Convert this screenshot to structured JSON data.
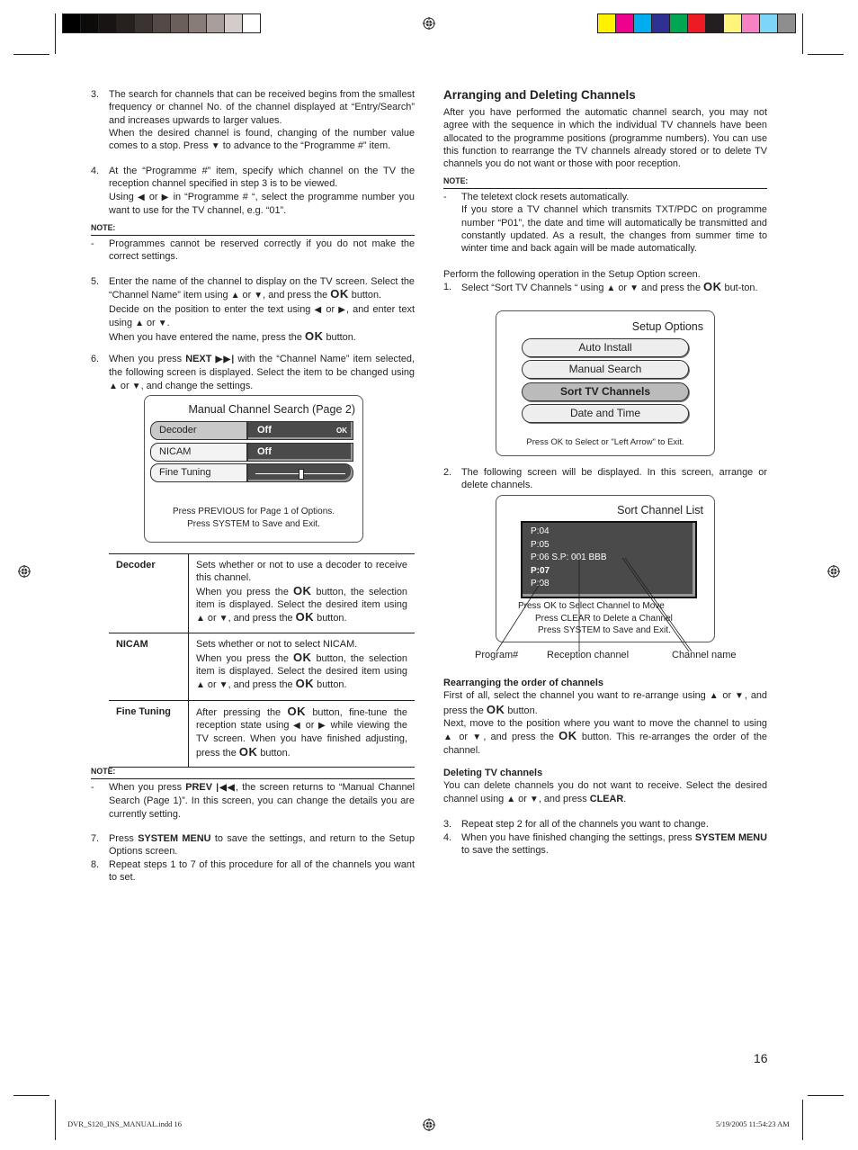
{
  "print_marks": {
    "gray_bar": [
      "#000000",
      "#0d0b0a",
      "#181413",
      "#26211f",
      "#3b3331",
      "#534a47",
      "#6b5f5b",
      "#887c78",
      "#a89e9b",
      "#d4cccb",
      "#ffffff"
    ],
    "color_bar": [
      "#fff200",
      "#ec008c",
      "#00aeef",
      "#2e3192",
      "#00a651",
      "#ed1c24",
      "#231f20",
      "#fff57d",
      "#f682c3",
      "#7dd6f7",
      "#8e8e8e"
    ],
    "footer_file": "DVR_S120_INS_MANUAL.indd   16",
    "footer_timestamp": "5/19/2005   11:54:23 AM"
  },
  "page_number": "16",
  "left": {
    "step3": {
      "num": "3.",
      "text1": "The search for channels that can be received begins from the smallest frequency or channel No. of the channel displayed at “Entry/Search” and increases upwards to larger values.",
      "text2a": "When the desired channel is found, changing of the number value comes to a stop. Press ",
      "text2b": " to advance to the “Programme #” item."
    },
    "step4": {
      "num": "4.",
      "text1": "At the “Programme #” item, specify which channel on the TV the reception channel specified in step 3 is to be viewed.",
      "text2a": "Using ",
      "text2b": " or ",
      "text2c": " in “Programme # “, select the programme number you want to use for the TV channel, e.g. “01”."
    },
    "note1": {
      "label": "NOTE:",
      "dash": "-",
      "text": "Programmes cannot be reserved correctly if you do not make the correct settings."
    },
    "step5": {
      "num": "5.",
      "a": "Enter the name of the channel to display on the TV screen. Select the “Channel Name” item using ",
      "b": " or ",
      "c": ", and press the ",
      "d": " button.",
      "e": "Decide on the position to enter the text using ",
      "f": " or ",
      "g": ", and enter text using ",
      "h": " or ",
      "i": ".",
      "j": "When you have entered the name, press the ",
      "k": " button."
    },
    "step6": {
      "num": "6.",
      "a": "When you press ",
      "next": "NEXT",
      "b": " with the “Channel Name” item selected, the following screen is displayed. Select the item to be changed using ",
      "c": " or ",
      "d": ", and change the settings."
    },
    "manual_screen": {
      "title": "Manual Channel Search  (Page 2)",
      "rows": [
        {
          "label": "Decoder",
          "value": "Off",
          "hint": "OK"
        },
        {
          "label": "NICAM",
          "value": "Off"
        },
        {
          "label": "Fine Tuning",
          "slider_position": 0.5
        }
      ],
      "footer1": "Press PREVIOUS for Page 1 of Options.",
      "footer2": "Press SYSTEM to Save and Exit."
    },
    "table": [
      {
        "key": "Decoder",
        "a": "Sets whether or not to use a decoder to receive this channel.",
        "b": "When you press the ",
        "c": " button, the selection item is displayed. Select the desired item using ",
        "d": " or ",
        "e": ", and press the ",
        "f": " button."
      },
      {
        "key": "NICAM",
        "a": "Sets whether or not to select NICAM.",
        "b": "When you press the ",
        "c": " button, the selection item is displayed. Select the desired item using ",
        "d": " or ",
        "e": ", and press the ",
        "f": " button."
      },
      {
        "key": "Fine Tuning",
        "a": "After pressing the ",
        "b": " button, fine-tune the reception state using ",
        "c": " or ",
        "d": " while viewing the TV screen. When you have finished adjusting, press the ",
        "e": " button."
      }
    ],
    "note2": {
      "label": "NOTE:",
      "dash": "-",
      "a": "When you press ",
      "prev": "PREV",
      "b": ", the screen returns to “Manual Channel Search (Page 1)”. In this screen, you can change the details you are currently setting."
    },
    "step7": {
      "num": "7.",
      "a": "Press ",
      "bold": "SYSTEM MENU",
      "b": " to save the settings, and return to the Setup Options screen."
    },
    "step8": {
      "num": "8.",
      "text": "Repeat steps 1 to 7 of this procedure for all of the channels you want to set."
    }
  },
  "right": {
    "heading": "Arranging and Deleting Channels",
    "intro": "After you have performed the automatic channel search, you may not agree with the sequence in which the individual TV channels have been allocated to the programme positions (programme numbers). You can use this function to rearrange the TV channels already stored or to delete TV channels you do not want or those with poor reception.",
    "note": {
      "label": "NOTE:",
      "dash": "-",
      "text1": "The teletext clock resets automatically.",
      "text2": "If you store a TV channel which transmits TXT/PDC on programme number “P01”, the date and time will automatically be transmitted and constantly updated. As a result, the changes from summer time to winter time and back again will be made automatically."
    },
    "perform": "Perform the following operation in the Setup Option screen.",
    "step1": {
      "num": "1.",
      "a": "Select “Sort TV Channels “ using ",
      "b": " or ",
      "c": " and press the ",
      "d": " but-ton."
    },
    "setup_screen": {
      "title": "Setup Options",
      "items": [
        {
          "label": "Auto Install",
          "selected": false
        },
        {
          "label": "Manual Search",
          "selected": false
        },
        {
          "label": "Sort TV Channels",
          "selected": true
        },
        {
          "label": "Date and Time",
          "selected": false
        }
      ],
      "footer": "Press OK to Select or \"Left Arrow\" to Exit."
    },
    "step2": {
      "num": "2.",
      "text": "The following screen will be displayed. In this screen, arrange or delete channels."
    },
    "sort_screen": {
      "title": "Sort Channel List",
      "channels": [
        "P:04",
        "P:05",
        "P:06 S.P: 001 BBB",
        "P:07",
        "P:08"
      ],
      "highlighted_index": 3,
      "footer1": "Press OK to Select Channel to Move",
      "footer2": "Press CLEAR to Delete a Channel",
      "footer3": "Press SYSTEM to Save and Exit.",
      "callouts": [
        "Program#",
        "Reception channel",
        "Channel name"
      ]
    },
    "rearrange": {
      "heading": "Rearranging the order of channels",
      "a": "First of all, select the channel you want to re-arrange using ",
      "b": " or ",
      "c": ", and press the ",
      "d": " button.",
      "e": "Next, move to the position where you want to move the channel to using ",
      "f": " or ",
      "g": ", and press the ",
      "h": " button. This re-arranges the order of the channel."
    },
    "delete": {
      "heading": "Deleting TV channels",
      "a": "You can delete channels you do not want to receive. Select the desired channel using ",
      "b": " or ",
      "c": ", and press ",
      "clear": "CLEAR",
      "d": "."
    },
    "step3": {
      "num": "3.",
      "text": "Repeat step 2 for all of the channels you want to change."
    },
    "step4": {
      "num": "4.",
      "a": "When you have finished changing the settings, press ",
      "bold": "SYSTEM MENU",
      "b": " to save the settings."
    }
  },
  "glyphs": {
    "up": "▲",
    "down": "▼",
    "left": "◀",
    "right": "▶",
    "ok": "OK",
    "next": "▶▶|",
    "prev": "|◀◀"
  }
}
